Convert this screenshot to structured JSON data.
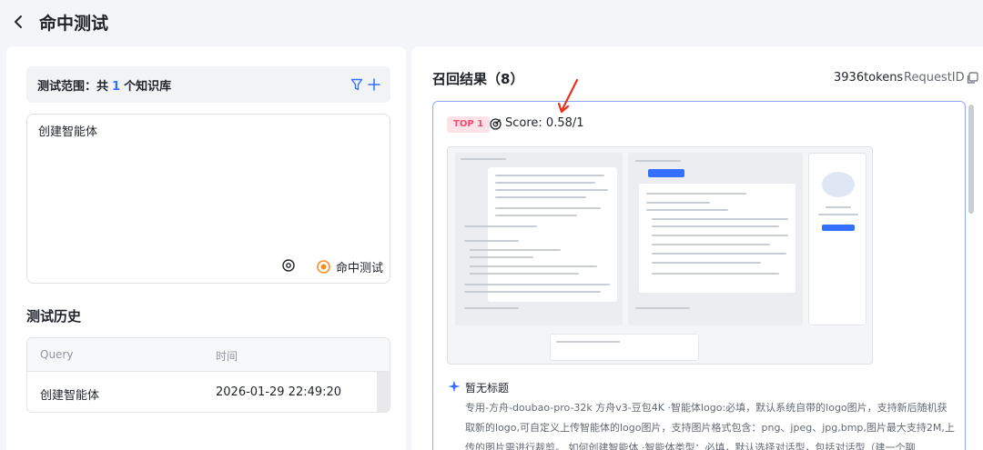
{
  "header": {
    "title": "命中测试"
  },
  "left": {
    "scope_prefix": "测试范围：共",
    "scope_count": "1",
    "scope_suffix": "个知识库",
    "query_text": "创建智能体",
    "hit_test_label": "命中测试",
    "history_title": "测试历史",
    "history_columns": [
      "Query",
      "时间"
    ],
    "history_rows": [
      {
        "query": "创建智能体",
        "time": "2026-01-29 22:49:20"
      }
    ]
  },
  "right": {
    "result_title": "召回结果（8）",
    "tokens": "3936tokens",
    "request_id_label": "RequestID",
    "result": {
      "badge": "TOP 1",
      "score": "Score: 0.58/1",
      "doc_title": "暂无标题",
      "doc_content": "专用-方舟-doubao-pro-32k 方舟v3-豆包4K ·智能体logo:必填，默认系统自带的logo图片，支持新后随机获取新的logo,可自定义上传智能体的logo图片，支持图片格式包含：png、jpeg、jpg,bmp,图片最大支持2M,上传的图片需进行裁剪。 如何创建智能体 ·智能体类型：必填，默认选择对话型，包括对话型（建一个聊"
    }
  },
  "icons": {
    "back": "chevron-left-icon",
    "filter": "filter-icon",
    "plus": "plus-icon",
    "target": "target-icon",
    "hit_test": "hit-test-icon",
    "copy": "copy-icon",
    "score": "score-icon",
    "doc": "sparkle-icon"
  },
  "colors": {
    "accent": "#3370ff",
    "badge_bg": "#fde2e7",
    "badge_text": "#f54a6d",
    "card_border": "#8fa6ff",
    "annotation_arrow": "#e8321e",
    "hit_test_icon": "#ff8c1a"
  }
}
